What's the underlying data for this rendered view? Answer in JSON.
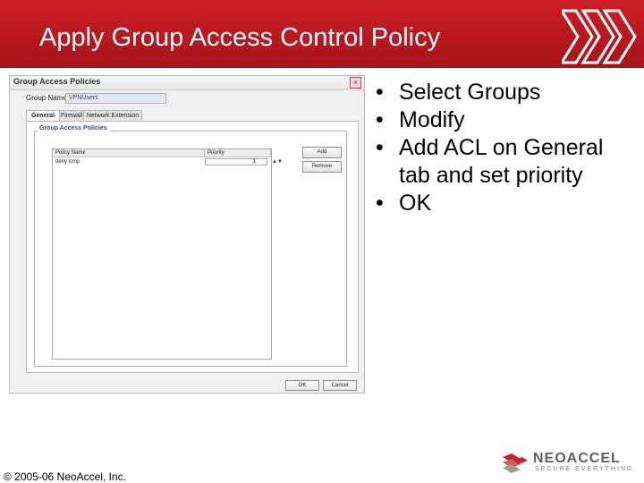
{
  "slide": {
    "title": "Apply Group Access Control Policy",
    "bullets": [
      "Select Groups",
      "Modify",
      "Add ACL on General tab and set priority",
      "OK"
    ],
    "copyright": "© 2005-06 NeoAccel, Inc."
  },
  "dialog": {
    "title": "Group Access Policies",
    "close_glyph": "×",
    "group_name_label": "Group Name",
    "group_name_value": "VPNUsers",
    "tabs": [
      "General",
      "Firewall",
      "Network Extension"
    ],
    "fieldset_legend": "Group Access Policies",
    "columns": [
      "Policy Name",
      "Priority"
    ],
    "rows": [
      {
        "policy_name": "deny icmp",
        "priority": "1"
      }
    ],
    "spin_glyph": "▲▼",
    "add_button": "Add",
    "remove_button": "Remove",
    "ok_button": "OK",
    "cancel_button": "Cancel"
  },
  "logo": {
    "name": "NEOACCEL",
    "tagline": "SECURE EVERYTHING"
  },
  "colors": {
    "title_bar": "#b8181e",
    "logo_red": "#c8252b"
  }
}
